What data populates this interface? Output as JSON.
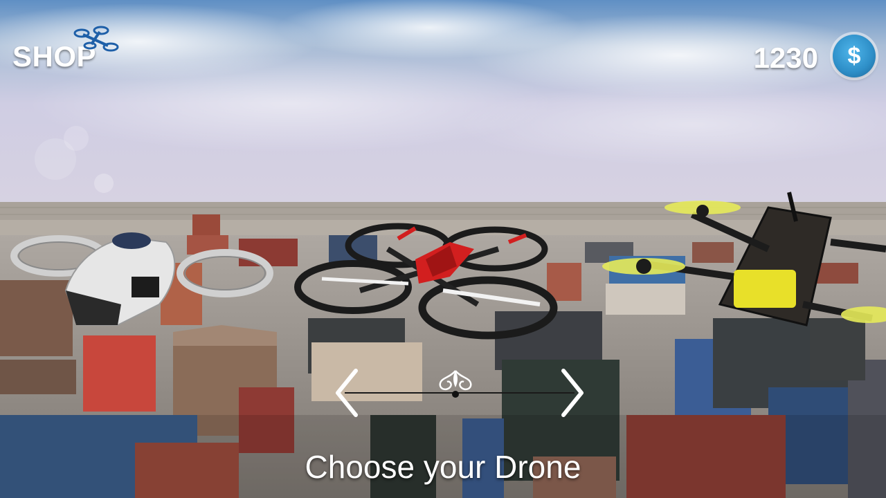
{
  "header": {
    "title": "SHOP",
    "shop_icon": "drone-icon",
    "coins": "1230",
    "coin_icon": "dollar-coin-icon",
    "coin_symbol": "$"
  },
  "carousel": {
    "left_icon": "chevron-left-icon",
    "right_icon": "chevron-right-icon",
    "center_icon": "ornament-icon"
  },
  "footer": {
    "label": "Choose your Drone"
  }
}
